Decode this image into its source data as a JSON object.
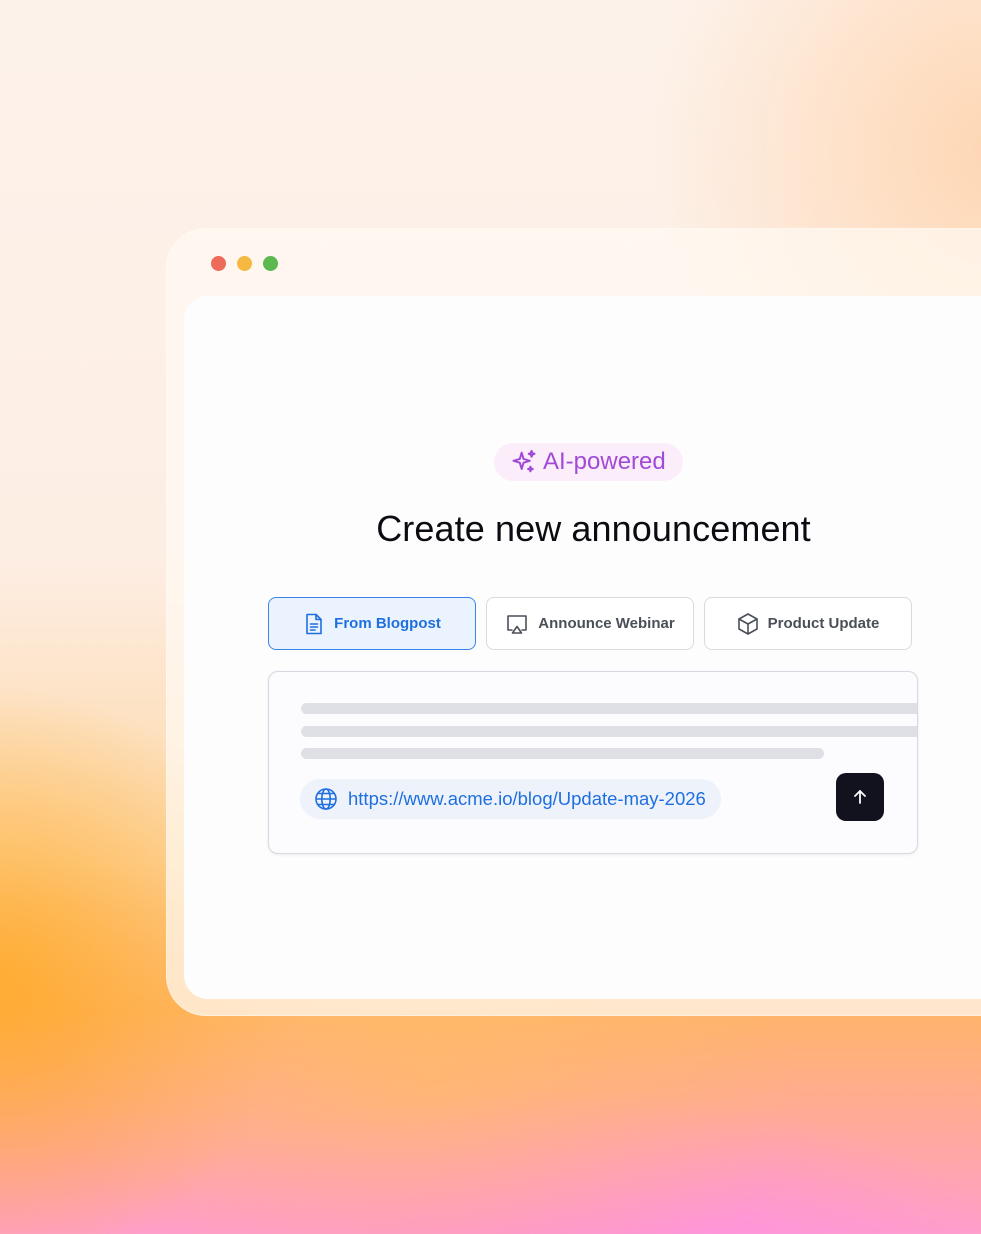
{
  "window": {
    "controls": [
      "close",
      "minimize",
      "maximize"
    ]
  },
  "badge": {
    "label": "AI-powered",
    "icon": "sparkles-icon"
  },
  "heading": "Create new announcement",
  "tabs": [
    {
      "label": "From Blogpost",
      "icon": "document-icon",
      "active": true
    },
    {
      "label": "Announce Webinar",
      "icon": "presentation-icon",
      "active": false
    },
    {
      "label": "Product Update",
      "icon": "box-icon",
      "active": false
    }
  ],
  "input": {
    "url": "https://www.acme.io/blog/Update-may-2026",
    "url_icon": "globe-icon",
    "submit_icon": "arrow-up-icon"
  },
  "colors": {
    "accent_blue": "#1f6fdf",
    "ai_purple": "#a14ad8",
    "submit_bg": "#12121e"
  }
}
